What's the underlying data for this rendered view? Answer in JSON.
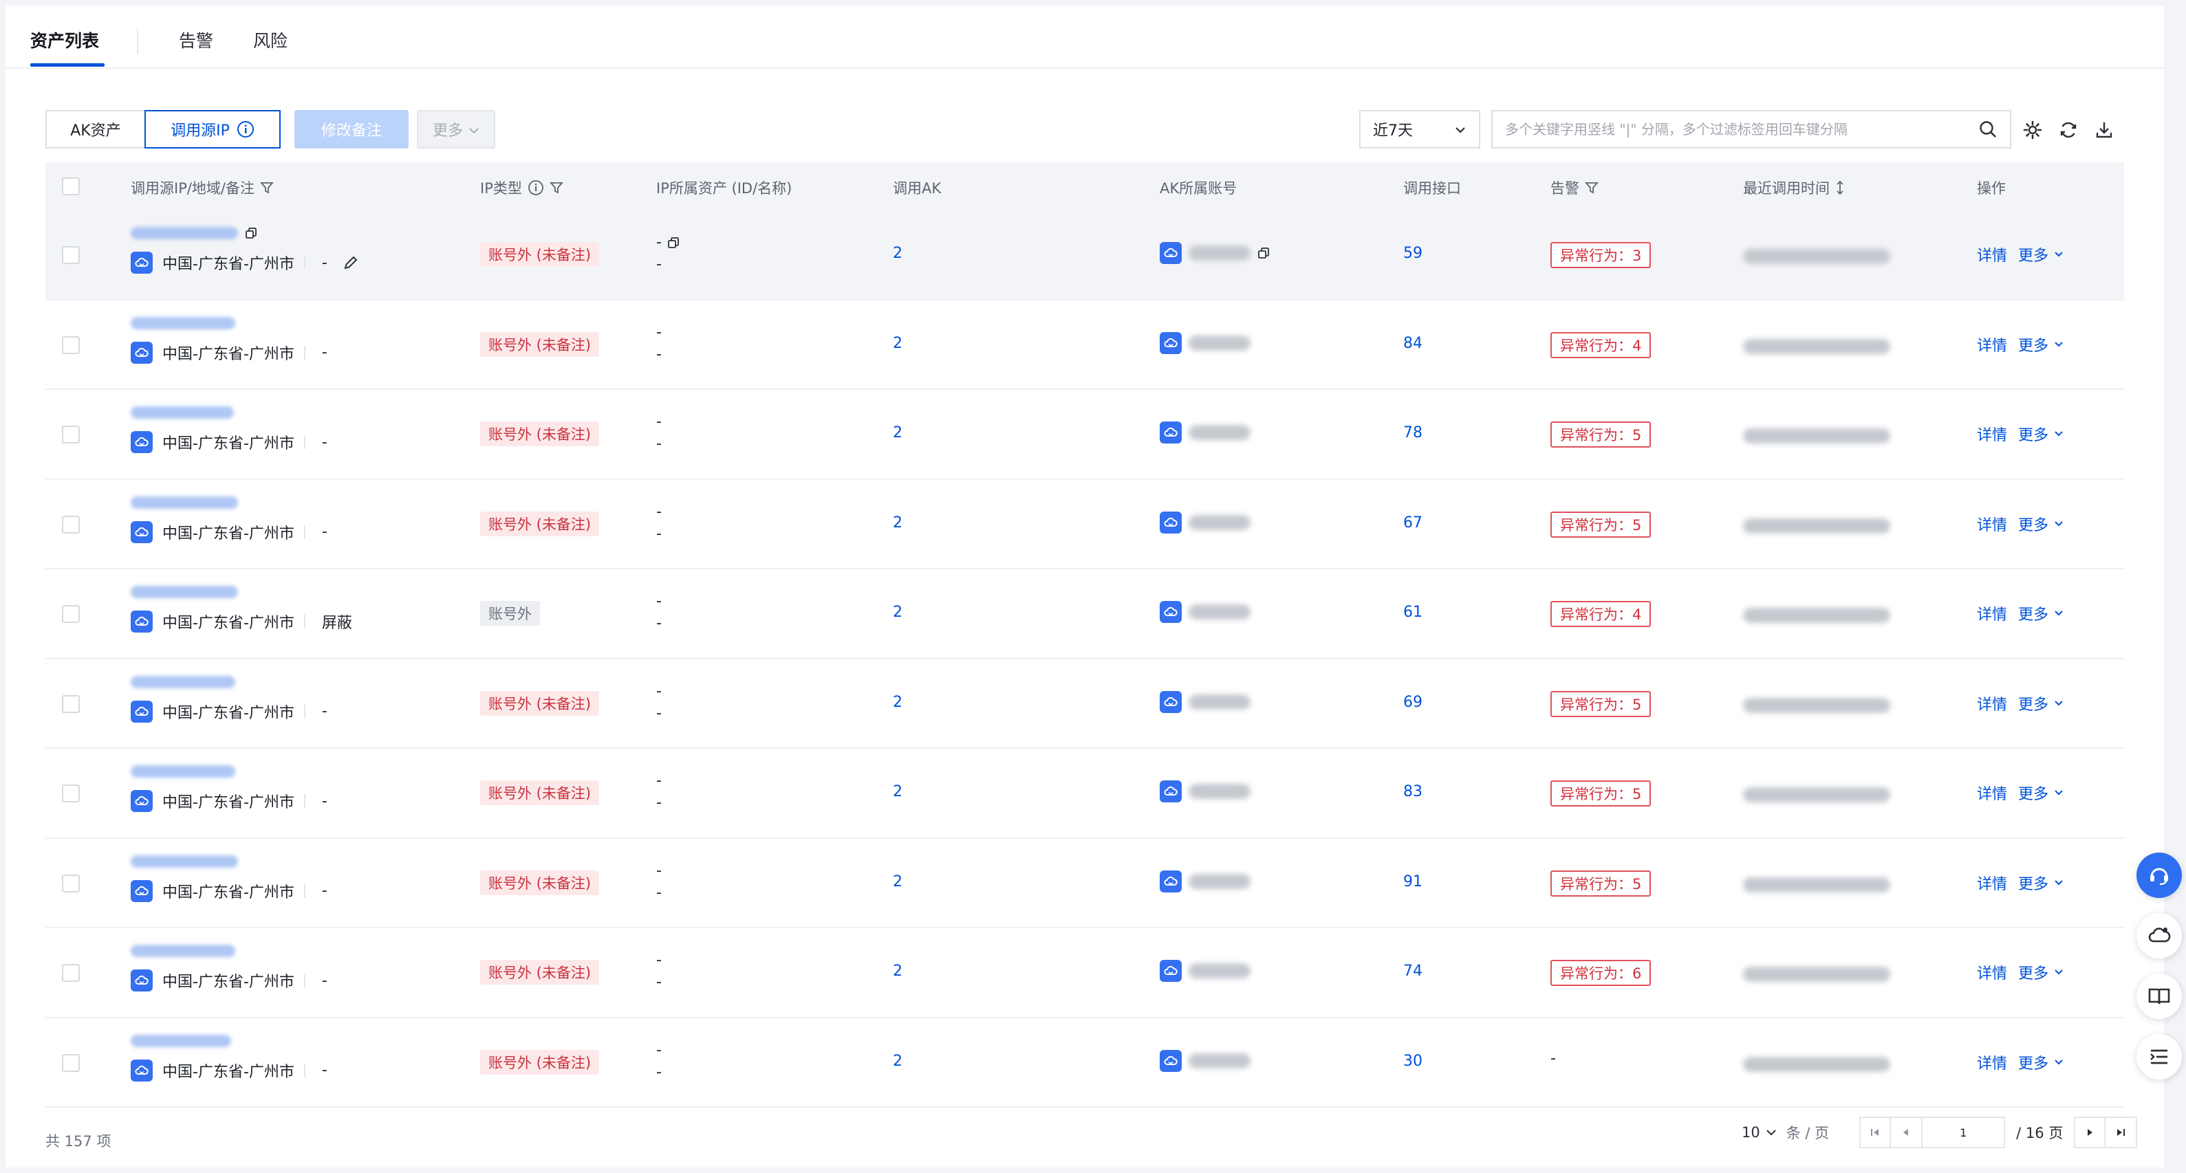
{
  "tabs": [
    {
      "label": "资产列表",
      "active": true
    },
    {
      "label": "告警",
      "active": false
    },
    {
      "label": "风险",
      "active": false
    }
  ],
  "toolbar": {
    "seg_ak": "AK资产",
    "seg_ip": "调用源IP",
    "btn_remark": "修改备注",
    "btn_more": "更多",
    "date_value": "近7天",
    "search_placeholder": "多个关键字用竖线 \"|\" 分隔，多个过滤标签用回车键分隔"
  },
  "columns": {
    "ip": "调用源IP/地域/备注",
    "iptype": "IP类型",
    "asset": "IP所属资产 (ID/名称)",
    "ak": "调用AK",
    "account": "AK所属账号",
    "api": "调用接口",
    "alert": "告警",
    "time": "最近调用时间",
    "ops": "操作"
  },
  "rows": [
    {
      "region": "中国-广东省-广州市",
      "remark": "-",
      "iptype": "账号外 (未备注)",
      "asset1": "-",
      "asset2": "-",
      "ak": "2",
      "api": "59",
      "alert": "异常行为：3",
      "detail": "详情",
      "more": "更多"
    },
    {
      "region": "中国-广东省-广州市",
      "remark": "-",
      "iptype": "账号外 (未备注)",
      "asset1": "-",
      "asset2": "-",
      "ak": "2",
      "api": "84",
      "alert": "异常行为：4",
      "detail": "详情",
      "more": "更多"
    },
    {
      "region": "中国-广东省-广州市",
      "remark": "-",
      "iptype": "账号外 (未备注)",
      "asset1": "-",
      "asset2": "-",
      "ak": "2",
      "api": "78",
      "alert": "异常行为：5",
      "detail": "详情",
      "more": "更多"
    },
    {
      "region": "中国-广东省-广州市",
      "remark": "-",
      "iptype": "账号外 (未备注)",
      "asset1": "-",
      "asset2": "-",
      "ak": "2",
      "api": "67",
      "alert": "异常行为：5",
      "detail": "详情",
      "more": "更多"
    },
    {
      "region": "中国-广东省-广州市",
      "remark": "屏蔽",
      "iptype": "账号外",
      "asset1": "-",
      "asset2": "-",
      "ak": "2",
      "api": "61",
      "alert": "异常行为：4",
      "detail": "详情",
      "more": "更多"
    },
    {
      "region": "中国-广东省-广州市",
      "remark": "-",
      "iptype": "账号外 (未备注)",
      "asset1": "-",
      "asset2": "-",
      "ak": "2",
      "api": "69",
      "alert": "异常行为：5",
      "detail": "详情",
      "more": "更多"
    },
    {
      "region": "中国-广东省-广州市",
      "remark": "-",
      "iptype": "账号外 (未备注)",
      "asset1": "-",
      "asset2": "-",
      "ak": "2",
      "api": "83",
      "alert": "异常行为：5",
      "detail": "详情",
      "more": "更多"
    },
    {
      "region": "中国-广东省-广州市",
      "remark": "-",
      "iptype": "账号外 (未备注)",
      "asset1": "-",
      "asset2": "-",
      "ak": "2",
      "api": "91",
      "alert": "异常行为：5",
      "detail": "详情",
      "more": "更多"
    },
    {
      "region": "中国-广东省-广州市",
      "remark": "-",
      "iptype": "账号外 (未备注)",
      "asset1": "-",
      "asset2": "-",
      "ak": "2",
      "api": "74",
      "alert": "异常行为：6",
      "detail": "详情",
      "more": "更多"
    },
    {
      "region": "中国-广东省-广州市",
      "remark": "-",
      "iptype": "账号外 (未备注)",
      "asset1": "-",
      "asset2": "-",
      "ak": "2",
      "api": "30",
      "alert": "-",
      "detail": "详情",
      "more": "更多"
    }
  ],
  "footer": {
    "total": "共 157 项",
    "page_size": "10",
    "per_page": "条 / 页",
    "current_page": "1",
    "total_pages": "/ 16 页"
  },
  "colors": {
    "primary": "#0052d9",
    "danger": "#d2303c",
    "danger_bg": "#fde8e9"
  }
}
